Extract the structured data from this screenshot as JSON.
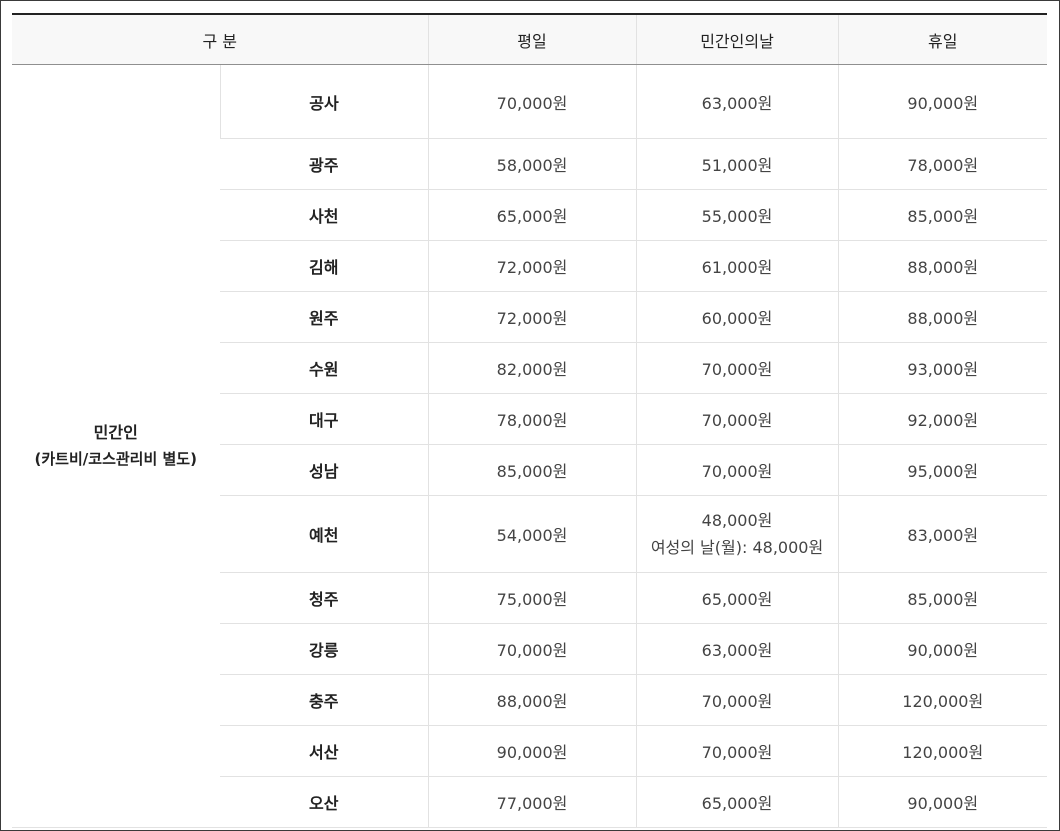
{
  "header": {
    "group_label": "구 분",
    "weekday": "평일",
    "civil_day": "민간인의날",
    "holiday": "휴일"
  },
  "category": {
    "title": "민간인",
    "subtitle": "(카트비/코스관리비 별도)"
  },
  "rows": [
    {
      "region": "공사",
      "weekday": "70,000원",
      "civil_day": "63,000원",
      "holiday": "90,000원"
    },
    {
      "region": "광주",
      "weekday": "58,000원",
      "civil_day": "51,000원",
      "holiday": "78,000원"
    },
    {
      "region": "사천",
      "weekday": "65,000원",
      "civil_day": "55,000원",
      "holiday": "85,000원"
    },
    {
      "region": "김해",
      "weekday": "72,000원",
      "civil_day": "61,000원",
      "holiday": "88,000원"
    },
    {
      "region": "원주",
      "weekday": "72,000원",
      "civil_day": "60,000원",
      "holiday": "88,000원"
    },
    {
      "region": "수원",
      "weekday": "82,000원",
      "civil_day": "70,000원",
      "holiday": "93,000원"
    },
    {
      "region": "대구",
      "weekday": "78,000원",
      "civil_day": "70,000원",
      "holiday": "92,000원"
    },
    {
      "region": "성남",
      "weekday": "85,000원",
      "civil_day": "70,000원",
      "holiday": "95,000원"
    },
    {
      "region": "예천",
      "weekday": "54,000원",
      "civil_day": "48,000원",
      "civil_day_note": "여성의 날(월): 48,000원",
      "holiday": "83,000원"
    },
    {
      "region": "청주",
      "weekday": "75,000원",
      "civil_day": "65,000원",
      "holiday": "85,000원"
    },
    {
      "region": "강릉",
      "weekday": "70,000원",
      "civil_day": "63,000원",
      "holiday": "90,000원"
    },
    {
      "region": "충주",
      "weekday": "88,000원",
      "civil_day": "70,000원",
      "holiday": "120,000원"
    },
    {
      "region": "서산",
      "weekday": "90,000원",
      "civil_day": "70,000원",
      "holiday": "120,000원"
    },
    {
      "region": "오산",
      "weekday": "77,000원",
      "civil_day": "65,000원",
      "holiday": "90,000원"
    }
  ]
}
